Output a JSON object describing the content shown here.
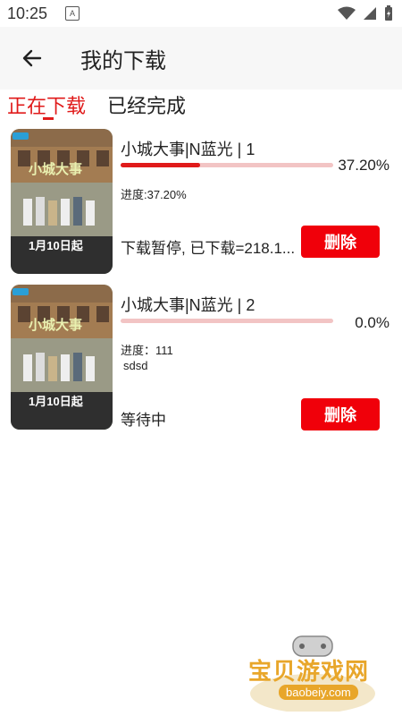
{
  "status_bar": {
    "time": "10:25",
    "a_icon": "A"
  },
  "header": {
    "title": "我的下载"
  },
  "tabs": [
    {
      "label": "正在下载",
      "active": true
    },
    {
      "label": "已经完成",
      "active": false
    }
  ],
  "downloads": [
    {
      "title": "小城大事|N蓝光 | 1",
      "progress_fraction": 0.372,
      "progress_percent": "37.20%",
      "progress_text": "进度:37.20%",
      "extra": "",
      "status": "下载暂停, 已下载=218.1...",
      "delete_label": "删除",
      "poster_text": "1月10日起",
      "poster_title": "小城大事"
    },
    {
      "title": "小城大事|N蓝光 | 2",
      "progress_fraction": 0.0,
      "progress_percent": "0.0%",
      "progress_text": "进度：111",
      "extra": "sdsd",
      "status": "等待中",
      "delete_label": "删除",
      "poster_text": "1月10日起",
      "poster_title": "小城大事"
    }
  ],
  "watermark": {
    "text": "宝贝游戏网",
    "url": "baobeiy.com"
  },
  "colors": {
    "accent": "#e01a1a",
    "button": "#f0000a",
    "track": "#f2c4c4",
    "watermark": "#e8a62a"
  }
}
